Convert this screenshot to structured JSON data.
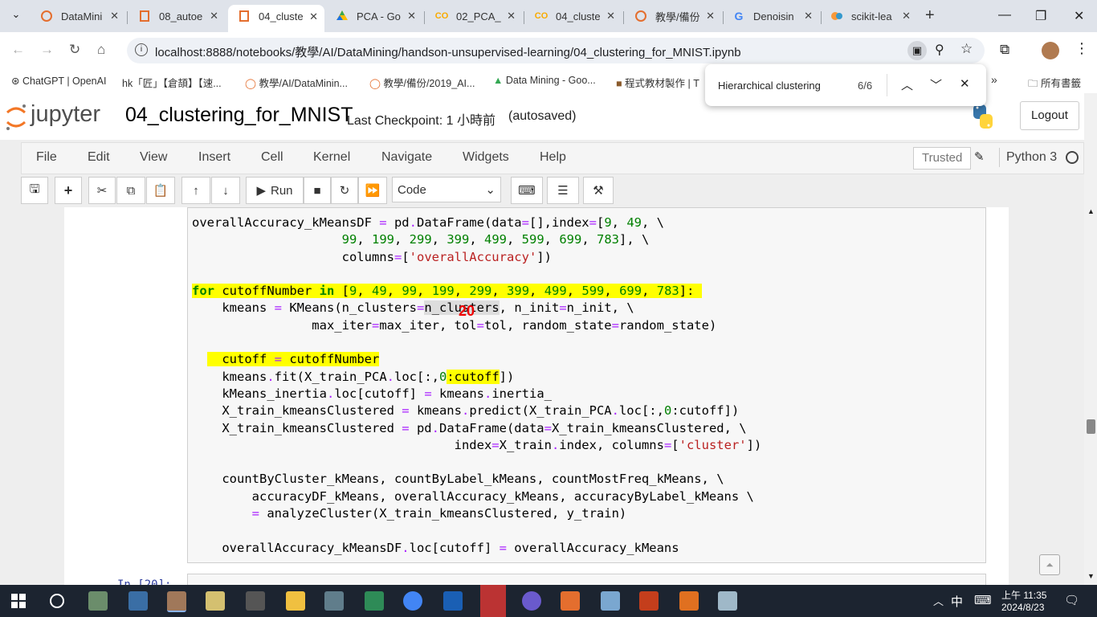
{
  "tabs": [
    {
      "title": "DataMini",
      "icon": "jupyter-tab-icon"
    },
    {
      "title": "08_autoe",
      "icon": "notebook-tab-icon"
    },
    {
      "title": "04_cluste",
      "icon": "notebook-tab-icon",
      "active": true
    },
    {
      "title": "PCA - Go",
      "icon": "google-drive-icon"
    },
    {
      "title": "02_PCA_",
      "icon": "colab-icon"
    },
    {
      "title": "04_cluste",
      "icon": "colab-icon"
    },
    {
      "title": "教學/備份",
      "icon": "jupyter-tab-icon"
    },
    {
      "title": "Denoisin",
      "icon": "google-icon"
    },
    {
      "title": "scikit-lea",
      "icon": "scikit-icon"
    }
  ],
  "address": {
    "url": "localhost:8888/notebooks/教學/AI/DataMining/handson-unsupervised-learning/04_clustering_for_MNIST.ipynb"
  },
  "bookmarks": [
    {
      "label": "ChatGPT | OpenAI"
    },
    {
      "label": "hk「匠」【倉頡】【速..."
    },
    {
      "label": "教學/AI/DataMinin..."
    },
    {
      "label": "教學/備份/2019_AI..."
    },
    {
      "label": "Data Mining - Goo..."
    },
    {
      "label": "程式教材製作 | T"
    }
  ],
  "bookmarks_more": "»",
  "bookmarks_folder": "所有書籤",
  "findbar": {
    "query": "Hierarchical clustering",
    "count": "6/6"
  },
  "jupyter": {
    "logo_text": "jupyter",
    "notebook_name": "04_clustering_for_MNIST",
    "checkpoint": "Last Checkpoint: 1 小時前",
    "autosaved": "(autosaved)",
    "logout": "Logout",
    "menu": [
      "File",
      "Edit",
      "View",
      "Insert",
      "Cell",
      "Kernel",
      "Navigate",
      "Widgets",
      "Help"
    ],
    "trusted": "Trusted",
    "kernel": "Python 3",
    "run_label": "Run",
    "cell_type": "Code"
  },
  "cursor_overlay": "20",
  "next_cell_prompt": "In [20]:",
  "taskbar": {
    "time": "上午 11:35",
    "date": "2024/8/23",
    "ime": "中"
  }
}
